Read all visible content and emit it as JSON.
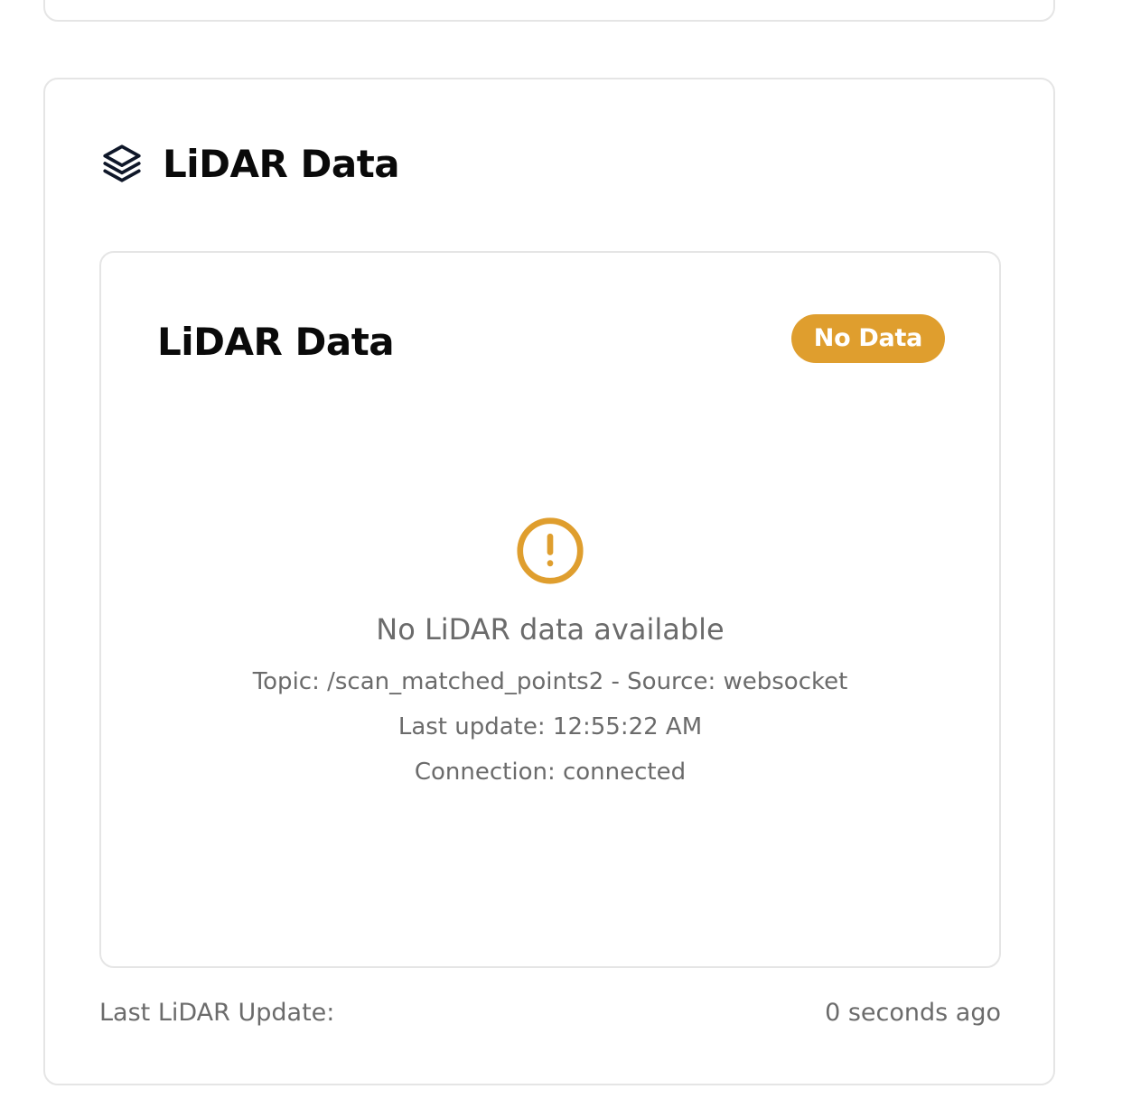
{
  "card": {
    "title": "LiDAR Data",
    "icon": "layers-icon"
  },
  "panel": {
    "title": "LiDAR Data",
    "status_badge": "No Data",
    "status_color": "#df9e2e"
  },
  "empty_state": {
    "icon": "alert-circle-icon",
    "message": "No LiDAR data available",
    "topic_line": "Topic: /scan_matched_points2 - Source: websocket",
    "last_update_line": "Last update: 12:55:22 AM",
    "connection_line": "Connection: connected"
  },
  "footer": {
    "label": "Last LiDAR Update:",
    "value": "0 seconds ago"
  }
}
